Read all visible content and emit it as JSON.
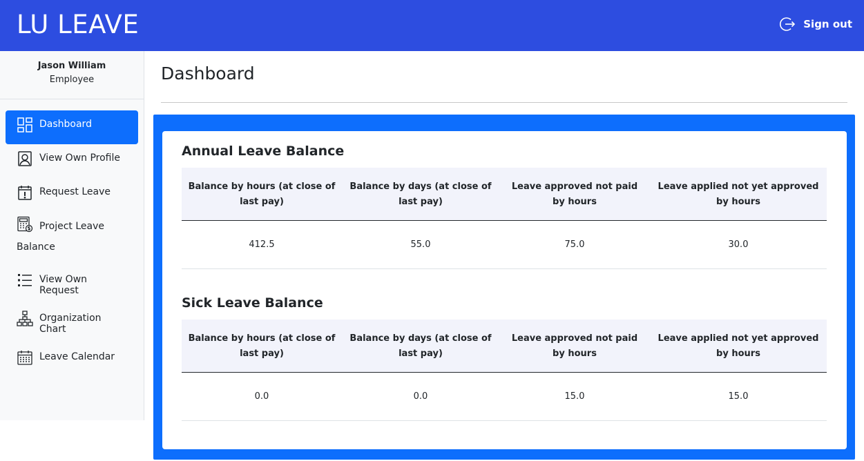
{
  "app": {
    "brand": "LU LEAVE",
    "signout_label": "Sign out"
  },
  "user": {
    "name": "Jason William",
    "role": "Employee"
  },
  "sidebar": {
    "items": [
      {
        "label": "Dashboard",
        "icon": "dashboard-icon",
        "active": true
      },
      {
        "label": "View Own Profile",
        "icon": "profile-icon"
      },
      {
        "label": "Request Leave",
        "icon": "calendar-alert-icon"
      },
      {
        "label": "Project Leave Balance",
        "icon": "calculator-icon"
      },
      {
        "label": "View Own Request",
        "icon": "list-icon"
      },
      {
        "label": "Organization Chart",
        "icon": "org-chart-icon"
      },
      {
        "label": "Leave Calendar",
        "icon": "calendar-icon"
      }
    ]
  },
  "main": {
    "title": "Dashboard",
    "annual": {
      "title": "Annual Leave Balance",
      "headers": [
        "Balance by hours (at close of last pay)",
        "Balance by days (at close of last pay)",
        "Leave approved not paid by hours",
        "Leave applied not yet approved by hours"
      ],
      "values": [
        "412.5",
        "55.0",
        "75.0",
        "30.0"
      ]
    },
    "sick": {
      "title": "Sick Leave Balance",
      "headers": [
        "Balance by hours (at close of last pay)",
        "Balance by days (at close of last pay)",
        "Leave approved not paid by hours",
        "Leave applied not yet approved by hours"
      ],
      "values": [
        "0.0",
        "0.0",
        "15.0",
        "15.0"
      ]
    }
  },
  "colors": {
    "topbar": "#2d4de0",
    "accent": "#0d6efd",
    "header_bg": "#f2f3fb"
  }
}
